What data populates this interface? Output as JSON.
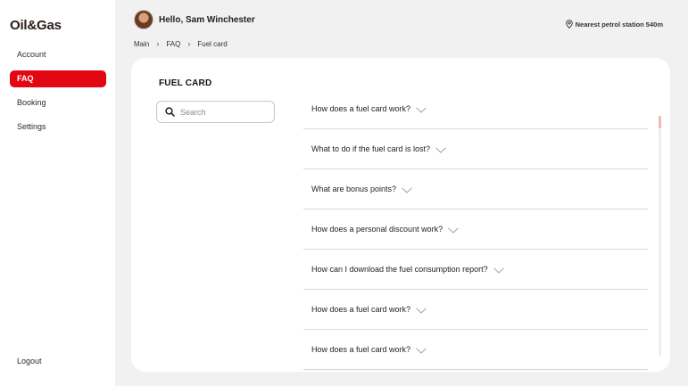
{
  "app": {
    "logo": "Oil&Gas"
  },
  "sidebar": {
    "items": [
      {
        "label": "Account"
      },
      {
        "label": "FAQ"
      },
      {
        "label": "Booking"
      },
      {
        "label": "Settings"
      }
    ],
    "logout_label": "Logout"
  },
  "header": {
    "greeting": "Hello, Sam Winchester",
    "station": "Nearest petrol station 540m"
  },
  "breadcrumb": [
    "Main",
    "FAQ",
    "Fuel card"
  ],
  "page": {
    "title": "FUEL CARD"
  },
  "search": {
    "placeholder": "Search"
  },
  "faq": [
    "How does a fuel card work?",
    "What to do if the fuel card is lost?",
    "What are bonus points?",
    "How does a personal discount work?",
    "How can I download the fuel consumption report?",
    "How does a fuel card work?",
    "How does a fuel card work?"
  ],
  "colors": {
    "accent": "#e30613",
    "background": "#f1f1f1",
    "card": "#ffffff"
  }
}
